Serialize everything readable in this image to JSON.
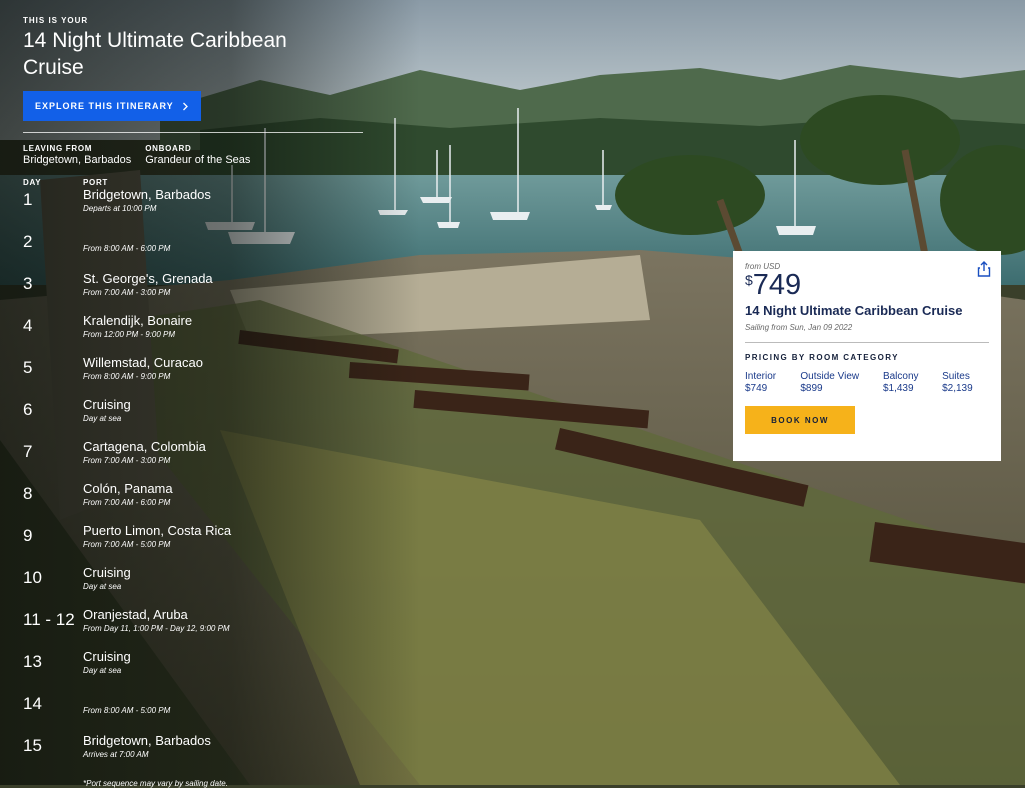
{
  "hero": {
    "kicker": "THIS IS YOUR",
    "title": "14 Night Ultimate Caribbean Cruise",
    "explore_label": "EXPLORE THIS ITINERARY"
  },
  "trip": {
    "leaving_label": "LEAVING FROM",
    "leaving_value": "Bridgetown, Barbados",
    "onboard_label": "ONBOARD",
    "onboard_value": "Grandeur of the Seas"
  },
  "itinerary": {
    "day_header": "DAY",
    "port_header": "PORT",
    "days": [
      {
        "day": "1",
        "port": "Bridgetown, Barbados",
        "time": "Departs at 10:00 PM"
      },
      {
        "day": "2",
        "port": "",
        "time": "From 8:00 AM - 6:00 PM"
      },
      {
        "day": "3",
        "port": "St. George's, Grenada",
        "time": "From 7:00 AM - 3:00 PM"
      },
      {
        "day": "4",
        "port": "Kralendijk, Bonaire",
        "time": "From 12:00 PM - 9:00 PM"
      },
      {
        "day": "5",
        "port": "Willemstad, Curacao",
        "time": "From 8:00 AM - 9:00 PM"
      },
      {
        "day": "6",
        "port": "Cruising",
        "time": "Day at sea"
      },
      {
        "day": "7",
        "port": "Cartagena, Colombia",
        "time": "From 7:00 AM - 3:00 PM"
      },
      {
        "day": "8",
        "port": "Colón, Panama",
        "time": "From 7:00 AM - 6:00 PM"
      },
      {
        "day": "9",
        "port": "Puerto Limon, Costa Rica",
        "time": "From 7:00 AM - 5:00 PM"
      },
      {
        "day": "10",
        "port": "Cruising",
        "time": "Day at sea"
      },
      {
        "day": "11 - 12",
        "port": "Oranjestad, Aruba",
        "time": "From Day 11, 1:00 PM - Day 12, 9:00 PM"
      },
      {
        "day": "13",
        "port": "Cruising",
        "time": "Day at sea"
      },
      {
        "day": "14",
        "port": "",
        "time": "From 8:00 AM - 5:00 PM"
      },
      {
        "day": "15",
        "port": "Bridgetown, Barbados",
        "time": "Arrives at 7:00 AM"
      }
    ],
    "note": "*Port sequence may vary by sailing date."
  },
  "card": {
    "from_label": "from USD",
    "currency": "$",
    "price": "749",
    "name": "14 Night Ultimate Caribbean Cruise",
    "sailing": "Sailing from Sun, Jan 09 2022",
    "pricing_label": "PRICING BY ROOM CATEGORY",
    "rooms": [
      {
        "name": "Interior",
        "price": "$749"
      },
      {
        "name": "Outside View",
        "price": "$899"
      },
      {
        "name": "Balcony",
        "price": "$1,439"
      },
      {
        "name": "Suites",
        "price": "$2,139"
      }
    ],
    "book_label": "BOOK NOW",
    "share_icon": "share-icon"
  },
  "colors": {
    "accent_blue": "#1260e8",
    "book_yellow": "#f6b21a",
    "navy": "#1a2a55"
  }
}
